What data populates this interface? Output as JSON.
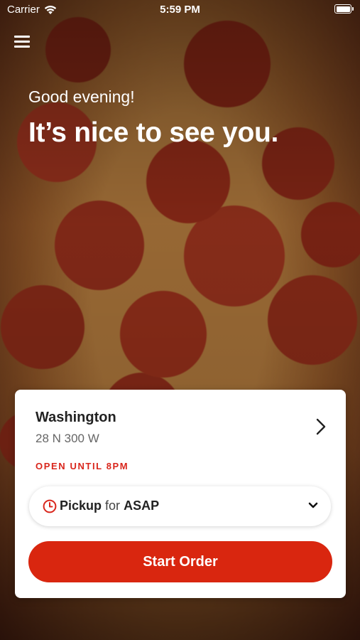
{
  "status_bar": {
    "carrier": "Carrier",
    "time": "5:59 PM"
  },
  "hero": {
    "greeting": "Good evening!",
    "headline": "It’s nice to see you."
  },
  "store_card": {
    "name": "Washington",
    "address": "28 N 300 W",
    "status": "OPEN UNTIL 8PM",
    "status_color": "#d9261c",
    "pickup": {
      "mode": "Pickup",
      "connector": "for",
      "time": "ASAP"
    },
    "start_order_label": "Start Order",
    "button_color": "#d9260f"
  },
  "icons": [
    "wifi-icon",
    "battery-icon",
    "menu-icon",
    "chevron-right-icon",
    "clock-icon",
    "chevron-down-icon"
  ]
}
